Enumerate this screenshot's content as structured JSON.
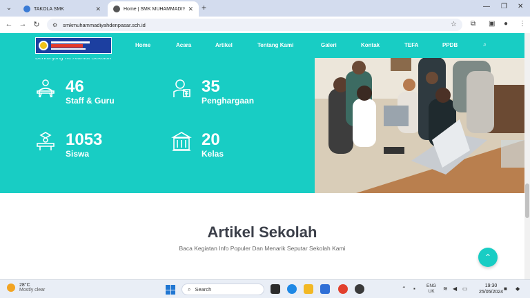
{
  "browser": {
    "tabs": [
      {
        "label": "TAKOLA SMK",
        "active": false
      },
      {
        "label": "Home | SMK MUHAMMADIYAH",
        "active": true
      }
    ],
    "url": "smkmuhammadiyahdenpasar.sch.id"
  },
  "site": {
    "nav": [
      "Home",
      "Acara",
      "Artikel",
      "Tentang Kami",
      "Galeri",
      "Kontak",
      "TEFA",
      "PPDB"
    ],
    "subtext": "Berkunjung Ke Alamat Sekolah",
    "stats": [
      {
        "number": "46",
        "label": "Staff & Guru",
        "icon": "teacher-icon"
      },
      {
        "number": "35",
        "label": "Penghargaan",
        "icon": "award-icon"
      },
      {
        "number": "1053",
        "label": "Siswa",
        "icon": "student-icon"
      },
      {
        "number": "20",
        "label": "Kelas",
        "icon": "building-icon"
      }
    ],
    "artikel": {
      "title": "Artikel Sekolah",
      "subtitle": "Baca Kegiatan Info Populer Dan Menarik Seputar Sekolah Kami"
    },
    "accent": "#18cdc4"
  },
  "taskbar": {
    "weather_temp": "28°C",
    "weather_desc": "Mostly clear",
    "search_placeholder": "Search",
    "lang": "ENG",
    "region": "UK",
    "time": "19:30",
    "date": "25/05/2024"
  }
}
